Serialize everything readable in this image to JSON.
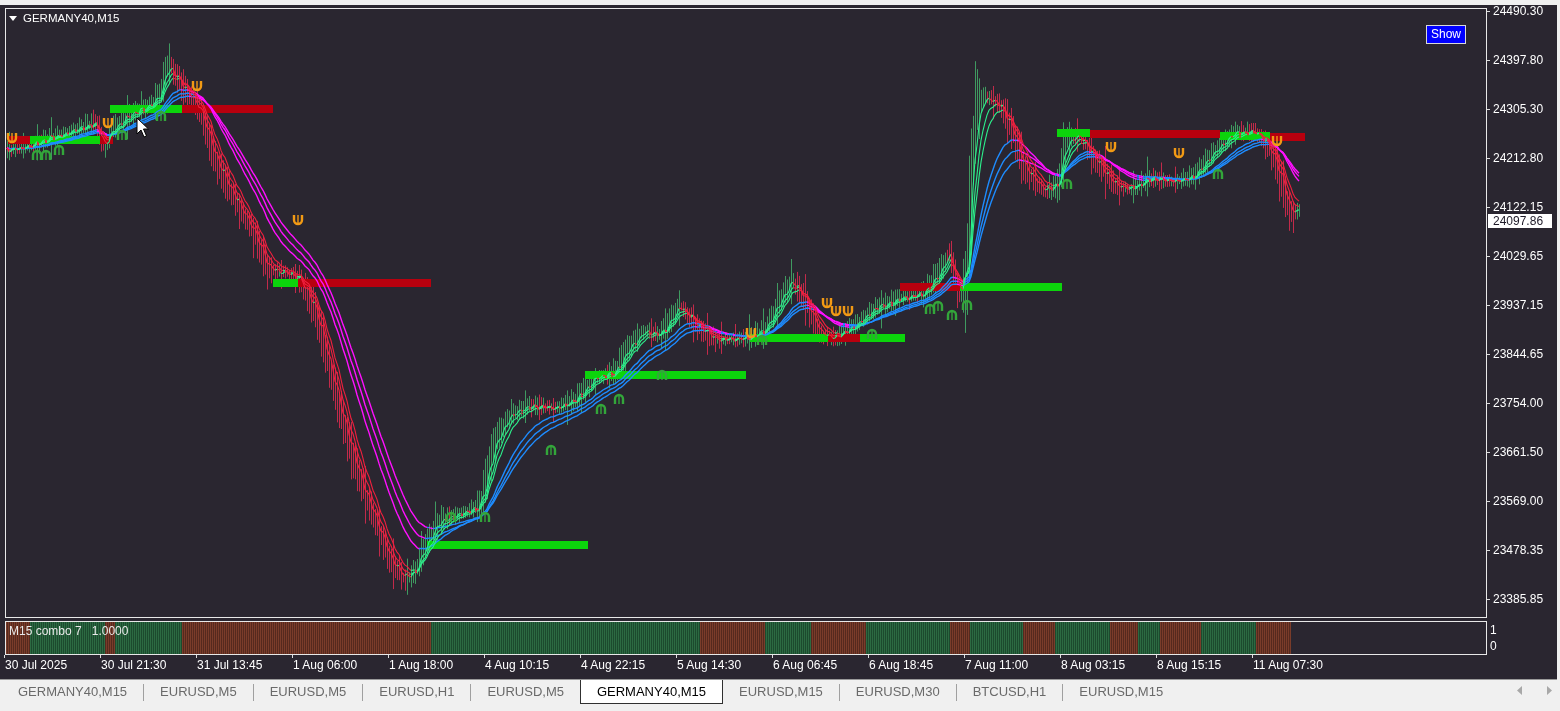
{
  "chart": {
    "title": "GERMANY40,M15",
    "show_button": "Show"
  },
  "price_axis": {
    "labels": [
      "24490.30",
      "24397.80",
      "24305.30",
      "24212.80",
      "24122.15",
      "24029.65",
      "23937.15",
      "23844.65",
      "23754.00",
      "23661.50",
      "23569.00",
      "23478.35",
      "23385.85"
    ],
    "current_price": "24097.86"
  },
  "indicator": {
    "name": "M15 combo 7",
    "value": "1.0000",
    "scale_labels": [
      "1",
      "0"
    ]
  },
  "time_axis": {
    "labels": [
      "30 Jul 2025",
      "30 Jul 21:30",
      "31 Jul 13:45",
      "1 Aug 06:00",
      "1 Aug 18:00",
      "4 Aug 10:15",
      "4 Aug 22:15",
      "5 Aug 14:30",
      "6 Aug 06:45",
      "6 Aug 18:45",
      "7 Aug 11:00",
      "8 Aug 03:15",
      "8 Aug 15:15",
      "11 Aug 07:30"
    ]
  },
  "tabs": [
    {
      "label": "GERMANY40,M15",
      "selected": false
    },
    {
      "label": "EURUSD,M5",
      "selected": false
    },
    {
      "label": "EURUSD,M5",
      "selected": false
    },
    {
      "label": "EURUSD,H1",
      "selected": false
    },
    {
      "label": "EURUSD,M5",
      "selected": false
    },
    {
      "label": "GERMANY40,M15",
      "selected": true
    },
    {
      "label": "EURUSD,M15",
      "selected": false
    },
    {
      "label": "EURUSD,M30",
      "selected": false
    },
    {
      "label": "BTCUSD,H1",
      "selected": false
    },
    {
      "label": "EURUSD,M15",
      "selected": false
    }
  ]
}
